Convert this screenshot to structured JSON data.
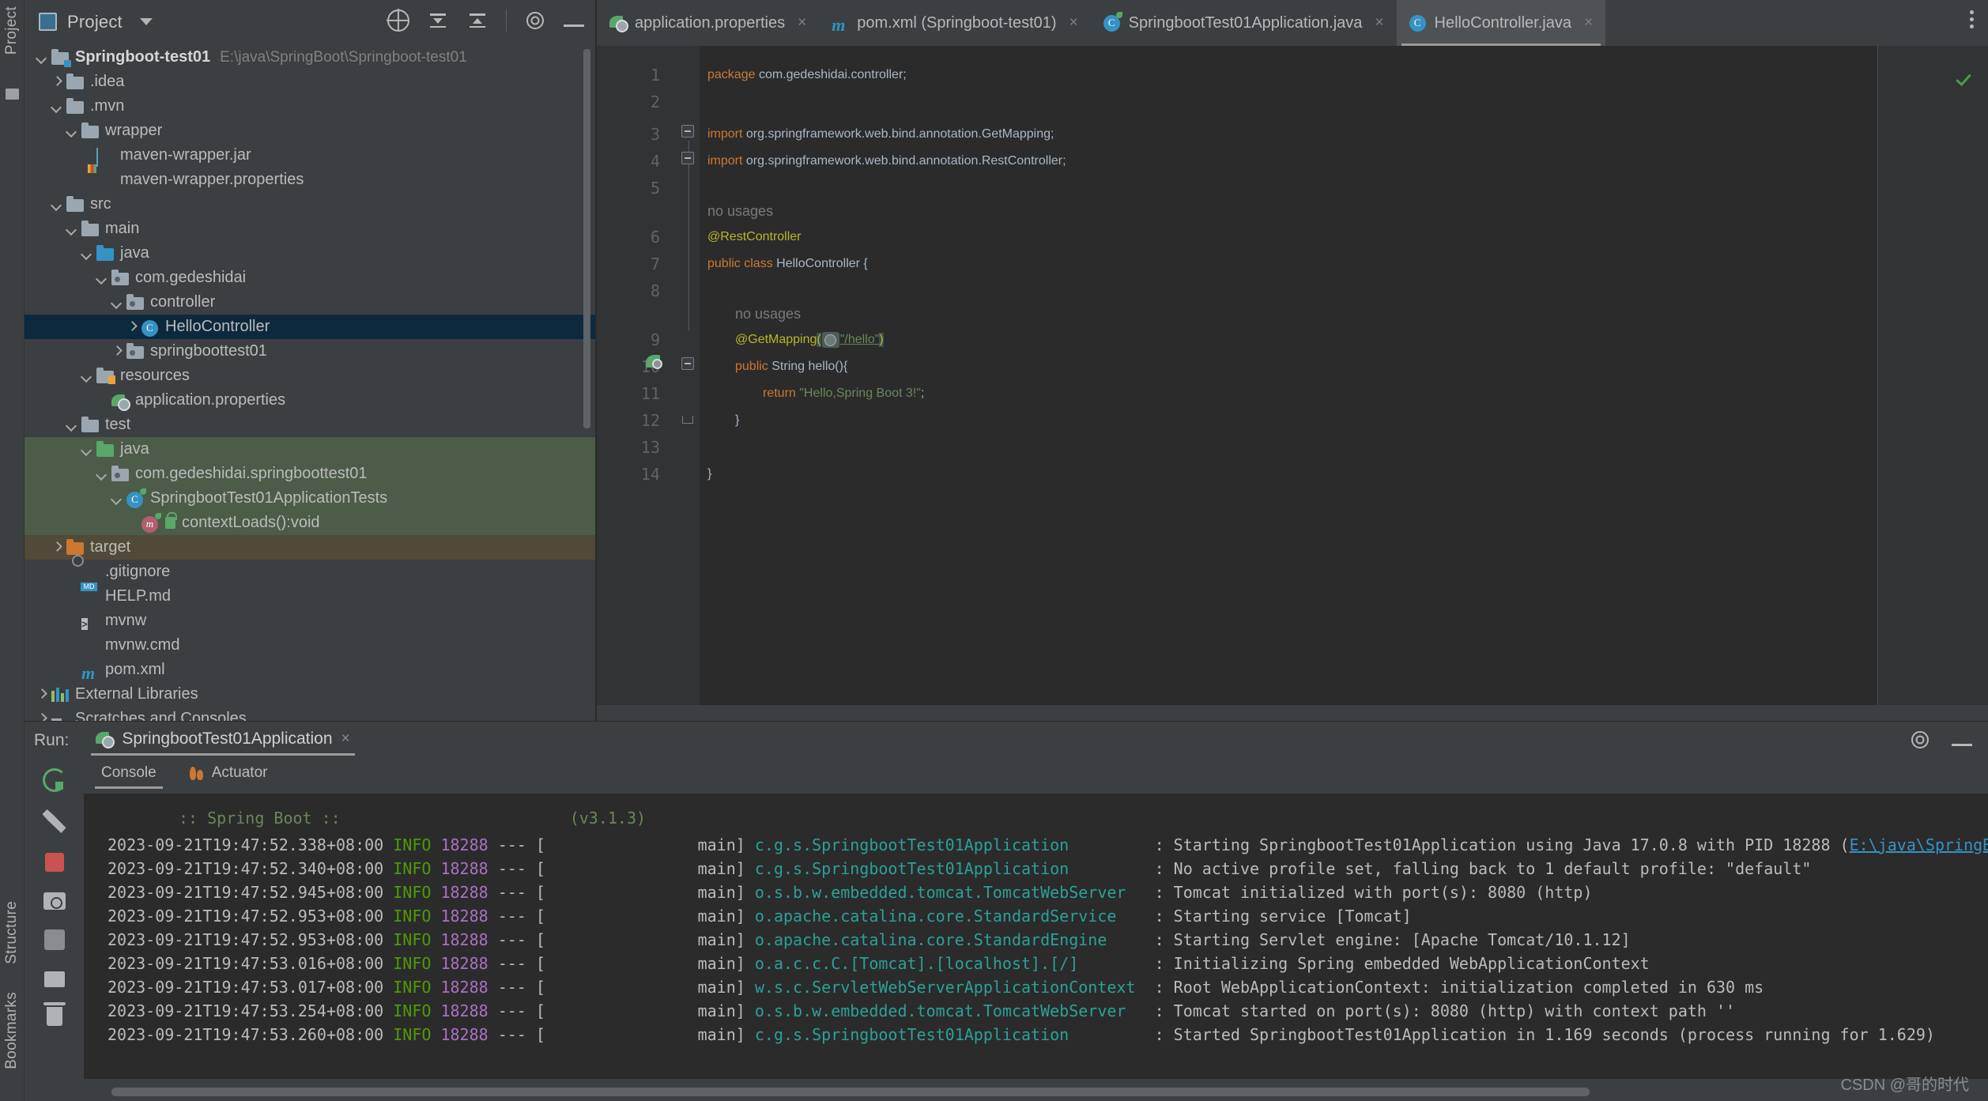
{
  "rail": {
    "project_label": "Project",
    "structure_label": "Structure",
    "bookmarks_label": "Bookmarks"
  },
  "project_panel": {
    "title": "Project",
    "tools": [
      "locate-icon",
      "expand-all-icon",
      "collapse-all-icon",
      "settings-icon",
      "hide-icon"
    ],
    "tree": [
      {
        "label": "Springboot-test01",
        "path": "E:\\java\\SpringBoot\\Springboot-test01",
        "indent": 0,
        "arrow": "down",
        "icon": "module-folder",
        "bold": true,
        "state": "none"
      },
      {
        "label": ".idea",
        "path": "",
        "indent": 1,
        "arrow": "right",
        "icon": "folder",
        "bold": false,
        "state": "none"
      },
      {
        "label": ".mvn",
        "path": "",
        "indent": 1,
        "arrow": "down",
        "icon": "folder",
        "bold": false,
        "state": "none"
      },
      {
        "label": "wrapper",
        "path": "",
        "indent": 2,
        "arrow": "down",
        "icon": "folder",
        "bold": false,
        "state": "none"
      },
      {
        "label": "maven-wrapper.jar",
        "path": "",
        "indent": 3,
        "arrow": "none",
        "icon": "jar",
        "bold": false,
        "state": "none"
      },
      {
        "label": "maven-wrapper.properties",
        "path": "",
        "indent": 3,
        "arrow": "none",
        "icon": "properties",
        "bold": false,
        "state": "none"
      },
      {
        "label": "src",
        "path": "",
        "indent": 1,
        "arrow": "down",
        "icon": "folder",
        "bold": false,
        "state": "none"
      },
      {
        "label": "main",
        "path": "",
        "indent": 2,
        "arrow": "down",
        "icon": "folder",
        "bold": false,
        "state": "none"
      },
      {
        "label": "java",
        "path": "",
        "indent": 3,
        "arrow": "down",
        "icon": "folder-blue",
        "bold": false,
        "state": "none"
      },
      {
        "label": "com.gedeshidai",
        "path": "",
        "indent": 4,
        "arrow": "down",
        "icon": "package",
        "bold": false,
        "state": "none"
      },
      {
        "label": "controller",
        "path": "",
        "indent": 5,
        "arrow": "down",
        "icon": "package",
        "bold": false,
        "state": "none"
      },
      {
        "label": "HelloController",
        "path": "",
        "indent": 6,
        "arrow": "right",
        "icon": "class",
        "bold": false,
        "state": "selected"
      },
      {
        "label": "springboottest01",
        "path": "",
        "indent": 5,
        "arrow": "right",
        "icon": "package",
        "bold": false,
        "state": "none"
      },
      {
        "label": "resources",
        "path": "",
        "indent": 3,
        "arrow": "down",
        "icon": "folder-resources",
        "bold": false,
        "state": "none"
      },
      {
        "label": "application.properties",
        "path": "",
        "indent": 4,
        "arrow": "none",
        "icon": "spring-leaf",
        "bold": false,
        "state": "none"
      },
      {
        "label": "test",
        "path": "",
        "indent": 2,
        "arrow": "down",
        "icon": "folder",
        "bold": false,
        "state": "none"
      },
      {
        "label": "java",
        "path": "",
        "indent": 3,
        "arrow": "down",
        "icon": "folder-green",
        "bold": false,
        "state": "test"
      },
      {
        "label": "com.gedeshidai.springboottest01",
        "path": "",
        "indent": 4,
        "arrow": "down",
        "icon": "package",
        "bold": false,
        "state": "test"
      },
      {
        "label": "SpringbootTest01ApplicationTests",
        "path": "",
        "indent": 5,
        "arrow": "down",
        "icon": "class-spring",
        "bold": false,
        "state": "test"
      },
      {
        "label": "contextLoads():void",
        "path": "",
        "indent": 6,
        "arrow": "none",
        "icon": "method-lock",
        "bold": false,
        "state": "test"
      },
      {
        "label": "target",
        "path": "",
        "indent": 1,
        "arrow": "right",
        "icon": "folder-orange",
        "bold": false,
        "state": "target"
      },
      {
        "label": ".gitignore",
        "path": "",
        "indent": 2,
        "arrow": "none",
        "icon": "gitignore",
        "bold": false,
        "state": "none"
      },
      {
        "label": "HELP.md",
        "path": "",
        "indent": 2,
        "arrow": "none",
        "icon": "markdown",
        "bold": false,
        "state": "none"
      },
      {
        "label": "mvnw",
        "path": "",
        "indent": 2,
        "arrow": "none",
        "icon": "shell",
        "bold": false,
        "state": "none"
      },
      {
        "label": "mvnw.cmd",
        "path": "",
        "indent": 2,
        "arrow": "none",
        "icon": "cmd",
        "bold": false,
        "state": "none"
      },
      {
        "label": "pom.xml",
        "path": "",
        "indent": 2,
        "arrow": "none",
        "icon": "maven",
        "bold": false,
        "state": "none"
      },
      {
        "label": "External Libraries",
        "path": "",
        "indent": 0,
        "arrow": "right",
        "icon": "libraries",
        "bold": false,
        "state": "none"
      },
      {
        "label": "Scratches and Consoles",
        "path": "",
        "indent": 0,
        "arrow": "right",
        "icon": "scratches",
        "bold": false,
        "state": "none"
      }
    ]
  },
  "editor": {
    "tabs": [
      {
        "label": "application.properties",
        "icon": "spring-leaf-icon",
        "active": false
      },
      {
        "label": "pom.xml (Springboot-test01)",
        "icon": "maven-icon",
        "active": false
      },
      {
        "label": "SpringbootTest01Application.java",
        "icon": "spring-class-icon",
        "active": false
      },
      {
        "label": "HelloController.java",
        "icon": "class-icon",
        "active": true
      }
    ],
    "lines": [
      {
        "num": "1",
        "type": "package",
        "kw": "package",
        "rest": " com.gedeshidai.controller;"
      },
      {
        "num": "2",
        "type": "blank",
        "kw": "",
        "rest": ""
      },
      {
        "num": "3",
        "type": "import",
        "kw": "import",
        "rest": " org.springframework.web.bind.annotation.",
        "tail": "GetMapping",
        "semi": ";"
      },
      {
        "num": "4",
        "type": "import",
        "kw": "import",
        "rest": " org.springframework.web.bind.annotation.",
        "tail": "RestController",
        "semi": ";"
      },
      {
        "num": "5",
        "type": "blank",
        "kw": "",
        "rest": ""
      },
      {
        "num": "6",
        "type": "annotation",
        "kw": "",
        "rest": "@RestController",
        "hint": "no usages"
      },
      {
        "num": "7",
        "type": "class",
        "kw": "public class",
        "rest": " HelloController {"
      },
      {
        "num": "8",
        "type": "blank",
        "kw": "",
        "rest": ""
      },
      {
        "num": "9",
        "type": "getmapping",
        "kw": "",
        "rest": "@GetMapping",
        "literal": "\"/hello\"",
        "hint": "no usages"
      },
      {
        "num": "10",
        "type": "method",
        "kw": "public",
        "rest": " String hello(){"
      },
      {
        "num": "11",
        "type": "return",
        "kw": "return",
        "rest": " ",
        "literal": "\"Hello,Spring Boot 3!\"",
        "semi": ";"
      },
      {
        "num": "12",
        "type": "close",
        "kw": "",
        "rest": "}"
      },
      {
        "num": "13",
        "type": "blank",
        "kw": "",
        "rest": ""
      },
      {
        "num": "14",
        "type": "close-outer",
        "kw": "",
        "rest": "}"
      }
    ]
  },
  "run": {
    "label": "Run:",
    "config_name": "SpringbootTest01Application",
    "close_symbol": "×",
    "subtabs": [
      {
        "label": "Console",
        "active": true
      },
      {
        "label": "Actuator",
        "active": false
      }
    ],
    "toolbar_icons": [
      "rerun-icon",
      "wrench-icon",
      "stop-icon",
      "camera-icon",
      "scroll-to-end-icon",
      "print-icon",
      "trash-icon",
      "pin-icon"
    ],
    "banner_text": ":: Spring Boot ::",
    "banner_version": "(v3.1.3)",
    "log": [
      {
        "time": "2023-09-21T19:47:52.338+08:00",
        "level": "INFO",
        "pid": "18288",
        "thread": "main",
        "logger": "c.g.s.SpringbootTest01Application",
        "message": ": Starting SpringbootTest01Application using Java 17.0.8 with PID 18288 (",
        "link": "E:\\java\\SpringBoot\\Sp"
      },
      {
        "time": "2023-09-21T19:47:52.340+08:00",
        "level": "INFO",
        "pid": "18288",
        "thread": "main",
        "logger": "c.g.s.SpringbootTest01Application",
        "message": ": No active profile set, falling back to 1 default profile: \"default\"",
        "link": ""
      },
      {
        "time": "2023-09-21T19:47:52.945+08:00",
        "level": "INFO",
        "pid": "18288",
        "thread": "main",
        "logger": "o.s.b.w.embedded.tomcat.TomcatWebServer",
        "message": ": Tomcat initialized with port(s): 8080 (http)",
        "link": ""
      },
      {
        "time": "2023-09-21T19:47:52.953+08:00",
        "level": "INFO",
        "pid": "18288",
        "thread": "main",
        "logger": "o.apache.catalina.core.StandardService",
        "message": ": Starting service [Tomcat]",
        "link": ""
      },
      {
        "time": "2023-09-21T19:47:52.953+08:00",
        "level": "INFO",
        "pid": "18288",
        "thread": "main",
        "logger": "o.apache.catalina.core.StandardEngine",
        "message": ": Starting Servlet engine: [Apache Tomcat/10.1.12]",
        "link": ""
      },
      {
        "time": "2023-09-21T19:47:53.016+08:00",
        "level": "INFO",
        "pid": "18288",
        "thread": "main",
        "logger": "o.a.c.c.C.[Tomcat].[localhost].[/]",
        "message": ": Initializing Spring embedded WebApplicationContext",
        "link": ""
      },
      {
        "time": "2023-09-21T19:47:53.017+08:00",
        "level": "INFO",
        "pid": "18288",
        "thread": "main",
        "logger": "w.s.c.ServletWebServerApplicationContext",
        "message": ": Root WebApplicationContext: initialization completed in 630 ms",
        "link": ""
      },
      {
        "time": "2023-09-21T19:47:53.254+08:00",
        "level": "INFO",
        "pid": "18288",
        "thread": "main",
        "logger": "o.s.b.w.embedded.tomcat.TomcatWebServer",
        "message": ": Tomcat started on port(s): 8080 (http) with context path ''",
        "link": ""
      },
      {
        "time": "2023-09-21T19:47:53.260+08:00",
        "level": "INFO",
        "pid": "18288",
        "thread": "main",
        "logger": "c.g.s.SpringbootTest01Application",
        "message": ": Started SpringbootTest01Application in 1.169 seconds (process running for 1.629)",
        "link": ""
      }
    ]
  },
  "watermark": "CSDN @哥的时代",
  "colors": {
    "background": "#3c3f41",
    "editor_bg": "#2b2b2b",
    "selection": "#0d293e",
    "test_scope": "#4c5c48",
    "target_scope": "#514a38",
    "keyword": "#cc7832",
    "string": "#6a8759",
    "annotation": "#bbb529",
    "logger": "#2aa198",
    "info": "#4e9a06",
    "pid": "#a771bf",
    "link": "#3592c4"
  }
}
